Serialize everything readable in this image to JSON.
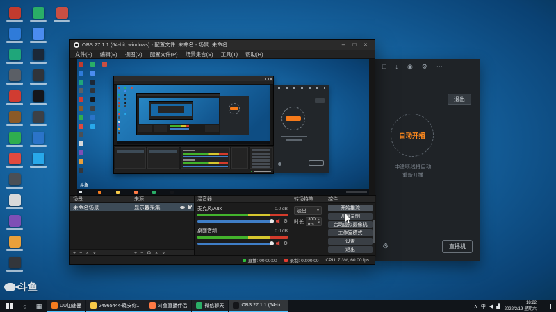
{
  "desktop": {
    "watermark_text": "斗鱼",
    "icons": [
      {
        "col": 0,
        "row": 0,
        "color": "#c23b2e"
      },
      {
        "col": 0,
        "row": 1,
        "color": "#2f7bd9"
      },
      {
        "col": 0,
        "row": 2,
        "color": "#1fa67a"
      },
      {
        "col": 0,
        "row": 3,
        "color": "#5b5f66"
      },
      {
        "col": 0,
        "row": 4,
        "color": "#d13c31"
      },
      {
        "col": 0,
        "row": 5,
        "color": "#8a5a28"
      },
      {
        "col": 0,
        "row": 6,
        "color": "#2fae4f"
      },
      {
        "col": 0,
        "row": 7,
        "color": "#e04a3f"
      },
      {
        "col": 0,
        "row": 8,
        "color": "#4a4f55"
      },
      {
        "col": 0,
        "row": 9,
        "color": "#d9d9d9"
      },
      {
        "col": 0,
        "row": 10,
        "color": "#7e4fb5"
      },
      {
        "col": 0,
        "row": 11,
        "color": "#e9a03b"
      },
      {
        "col": 0,
        "row": 12,
        "color": "#33363b"
      },
      {
        "col": 1,
        "row": 0,
        "color": "#2aae67"
      },
      {
        "col": 1,
        "row": 1,
        "color": "#4b8cf0"
      },
      {
        "col": 1,
        "row": 2,
        "color": "#1b2838"
      },
      {
        "col": 1,
        "row": 3,
        "color": "#30343a"
      },
      {
        "col": 1,
        "row": 4,
        "color": "#15161a"
      },
      {
        "col": 1,
        "row": 5,
        "color": "#3c4046"
      },
      {
        "col": 1,
        "row": 6,
        "color": "#2b74c9"
      },
      {
        "col": 1,
        "row": 7,
        "color": "#28a8ea"
      },
      {
        "col": 2,
        "row": 0,
        "color": "#c94f43"
      }
    ]
  },
  "obs": {
    "window_title": "OBS 27.1.1 (64-bit, windows) - 配置文件: 未命名 - 场景: 未命名",
    "window_buttons": [
      "–",
      "□",
      "×"
    ],
    "menu": [
      "文件(F)",
      "编辑(E)",
      "视图(V)",
      "配置文件(P)",
      "场景集合(S)",
      "工具(T)",
      "帮助(H)"
    ],
    "docks": {
      "scenes": {
        "title": "场景",
        "items": [
          "未命名场景"
        ],
        "toolbar": [
          "+",
          "−",
          "∧",
          "∨"
        ]
      },
      "sources": {
        "title": "来源",
        "items": [
          "显示器采集"
        ],
        "toolbar": [
          "+",
          "−",
          "⚙",
          "∧",
          "∨"
        ]
      },
      "mixer": {
        "title": "混音器",
        "channels": [
          {
            "name": "麦克风/Aux",
            "db": "0.0 dB"
          },
          {
            "name": "桌面音频",
            "db": "0.0 dB"
          }
        ]
      },
      "transitions": {
        "title": "转场特效",
        "selected": "淡出",
        "duration_label": "时长",
        "duration_value": "300 ms"
      },
      "controls": {
        "title": "控件",
        "buttons": [
          "开始推流",
          "开始录制",
          "启动虚拟摄像机",
          "工作室模式",
          "设置",
          "退出"
        ]
      }
    },
    "status": {
      "live_label": "直播: 00:00:00",
      "rec_label": "录制: 00:00:00",
      "cpu_label": "CPU: 7.3%, 60.00 fps"
    }
  },
  "douyu": {
    "top_icons": [
      {
        "name": "monitor-icon",
        "glyph": "□"
      },
      {
        "name": "download-icon",
        "glyph": "↓"
      },
      {
        "name": "user-icon",
        "glyph": "◉"
      },
      {
        "name": "gear-icon",
        "glyph": "⚙"
      },
      {
        "name": "more-icon",
        "glyph": "⋯"
      }
    ],
    "exit_button": "退出",
    "auto_start_button": "自动开播",
    "hint_line1": "中途断线将自动",
    "hint_line2": "重新开播",
    "machine_button": "直播机"
  },
  "taskbar": {
    "apps": [
      {
        "label": "UU加速器",
        "color": "#f57c1f",
        "active": false
      },
      {
        "label": "24965444-晚安你...",
        "color": "#f7c948",
        "active": false
      },
      {
        "label": "斗鱼直播伴侣",
        "color": "#ff7a45",
        "active": false
      },
      {
        "label": "微信聊天",
        "color": "#2aae67",
        "active": false
      },
      {
        "label": "OBS 27.1.1 (64-bi...",
        "color": "#14161a",
        "active": true
      }
    ],
    "tray_icons": [
      {
        "name": "chevron-up-icon",
        "glyph": "∧"
      },
      {
        "name": "ime-indicator",
        "glyph": "中"
      },
      {
        "name": "volume-icon",
        "glyph": "◀"
      },
      {
        "name": "network-icon",
        "glyph": "▟"
      }
    ],
    "tray_time": "18:22",
    "tray_date": "2022/2/19 星期六"
  }
}
